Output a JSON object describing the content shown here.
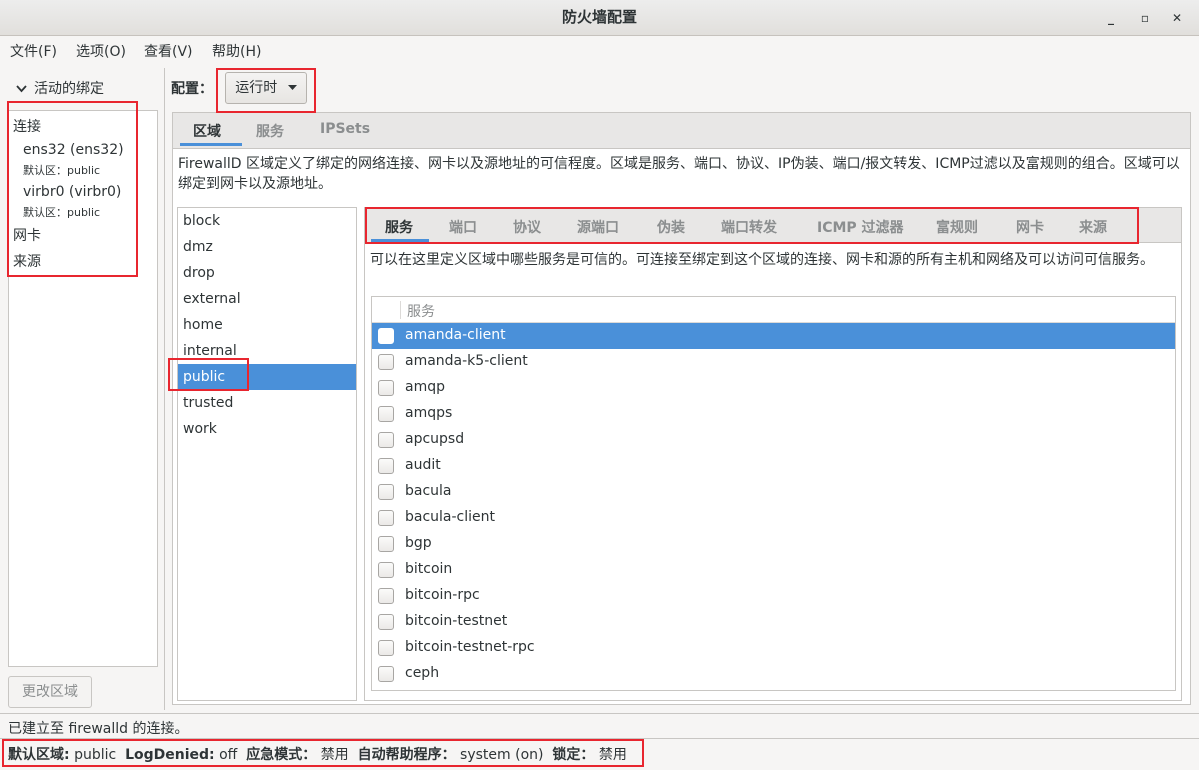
{
  "window": {
    "title": "防火墙配置",
    "minimize": "_",
    "maximize": "▫",
    "close": "✕"
  },
  "menu": [
    "文件(F)",
    "选项(O)",
    "查看(V)",
    "帮助(H)"
  ],
  "left": {
    "header": "活动的绑定",
    "connections_label": "连接",
    "connections": [
      {
        "name": "ens32 (ens32)",
        "zone": "默认区：public"
      },
      {
        "name": "virbr0 (virbr0)",
        "zone": "默认区：public"
      }
    ],
    "interfaces_label": "网卡",
    "sources_label": "来源",
    "change_zone_button": "更改区域"
  },
  "config": {
    "label": "配置：",
    "value": "运行时"
  },
  "top_tabs": [
    "区域",
    "服务",
    "IPSets"
  ],
  "zone_description": "FirewallD 区域定义了绑定的网络连接、网卡以及源地址的可信程度。区域是服务、端口、协议、IP伪装、端口/报文转发、ICMP过滤以及富规则的组合。区域可以绑定到网卡以及源地址。",
  "zones": [
    "block",
    "dmz",
    "drop",
    "external",
    "home",
    "internal",
    "public",
    "trusted",
    "work"
  ],
  "selected_zone": "public",
  "sub_tabs": [
    "服务",
    "端口",
    "协议",
    "源端口",
    "伪装",
    "端口转发",
    "ICMP 过滤器",
    "富规则",
    "网卡",
    "来源"
  ],
  "services_description": "可以在这里定义区域中哪些服务是可信的。可连接至绑定到这个区域的连接、网卡和源的所有主机和网络及可以访问可信服务。",
  "services_header": "服务",
  "services": [
    "amanda-client",
    "amanda-k5-client",
    "amqp",
    "amqps",
    "apcupsd",
    "audit",
    "bacula",
    "bacula-client",
    "bgp",
    "bitcoin",
    "bitcoin-rpc",
    "bitcoin-testnet",
    "bitcoin-testnet-rpc",
    "ceph"
  ],
  "selected_service": "amanda-client",
  "status": {
    "connection": "已建立至  firewalld 的连接。",
    "default_zone_label": "默认区域:",
    "default_zone": "public",
    "logdenied_label": "LogDenied:",
    "logdenied": "off",
    "panic_label": "应急模式：",
    "panic": "禁用",
    "helper_label": "自动帮助程序：",
    "helper": "system (on)",
    "lockdown_label": "锁定：",
    "lockdown": "禁用"
  },
  "highlight_color": "#e8262f",
  "selection_color": "#4a90d9"
}
